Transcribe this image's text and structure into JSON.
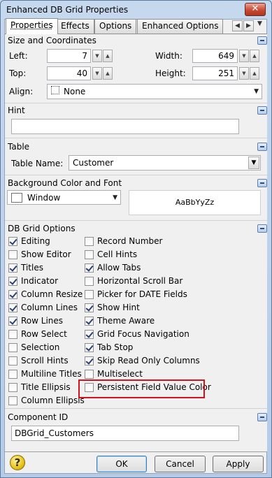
{
  "window": {
    "title": "Enhanced DB Grid Properties",
    "close_glyph": "✕"
  },
  "tabs": [
    {
      "label": "Properties",
      "active": true
    },
    {
      "label": "Effects"
    },
    {
      "label": "Options"
    },
    {
      "label": "Enhanced Options"
    }
  ],
  "tab_scroll": {
    "left": "◀",
    "right": "▶",
    "menu": "▼"
  },
  "size": {
    "header": "Size and Coordinates",
    "left_label": "Left:",
    "left_value": "7",
    "top_label": "Top:",
    "top_value": "40",
    "width_label": "Width:",
    "width_value": "649",
    "height_label": "Height:",
    "height_value": "251",
    "align_label": "Align:",
    "align_value": "None"
  },
  "hint": {
    "header": "Hint",
    "value": ""
  },
  "table": {
    "header": "Table",
    "name_label": "Table Name:",
    "name_value": "Customer"
  },
  "background": {
    "header": "Background Color and Font",
    "color_value": "Window",
    "font_preview": "AaBbYyZz"
  },
  "grid_options": {
    "header": "DB Grid Options",
    "left": [
      {
        "label": "Editing",
        "checked": true
      },
      {
        "label": "Show Editor",
        "checked": false
      },
      {
        "label": "Titles",
        "checked": true
      },
      {
        "label": "Indicator",
        "checked": true
      },
      {
        "label": "Column Resize",
        "checked": true
      },
      {
        "label": "Column Lines",
        "checked": true
      },
      {
        "label": "Row Lines",
        "checked": true
      },
      {
        "label": "Row Select",
        "checked": false
      },
      {
        "label": "Selection",
        "checked": false
      },
      {
        "label": "Scroll Hints",
        "checked": false
      },
      {
        "label": "Multiline Titles",
        "checked": false
      },
      {
        "label": "Title Ellipsis",
        "checked": false
      },
      {
        "label": "Column Ellipsis",
        "checked": false
      }
    ],
    "right": [
      {
        "label": "Record Number",
        "checked": false
      },
      {
        "label": "Cell Hints",
        "checked": false
      },
      {
        "label": "Allow Tabs",
        "checked": true
      },
      {
        "label": "Horizontal Scroll Bar",
        "checked": false
      },
      {
        "label": "Picker for DATE Fields",
        "checked": false
      },
      {
        "label": "Show Hint",
        "checked": true
      },
      {
        "label": "Theme Aware",
        "checked": true
      },
      {
        "label": "Grid Focus Navigation",
        "checked": true
      },
      {
        "label": "Tab Stop",
        "checked": true
      },
      {
        "label": "Skip Read Only Columns",
        "checked": true
      },
      {
        "label": "Multiselect",
        "checked": false
      },
      {
        "label": "Persistent Field Value Color",
        "checked": false
      }
    ]
  },
  "component": {
    "header": "Component ID",
    "value": "DBGrid_Customers"
  },
  "buttons": {
    "help": "?",
    "ok": "OK",
    "cancel": "Cancel",
    "apply": "Apply"
  },
  "colors": {
    "highlight": "#d3121f",
    "accent": "#3c7fb1"
  }
}
